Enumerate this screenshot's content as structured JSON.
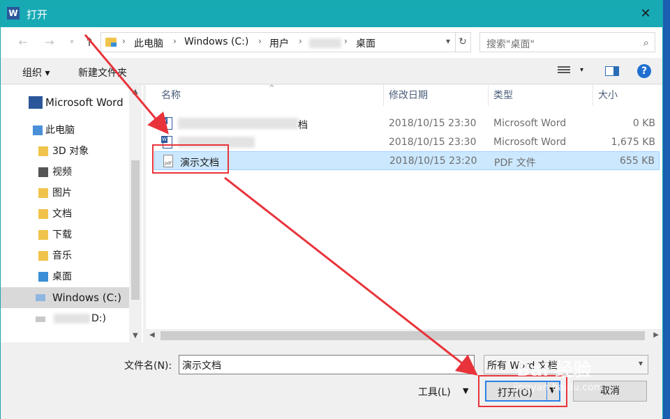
{
  "title": "打开",
  "app_icon": "word-icon",
  "nav": {
    "back_icon": "back-arrow-icon",
    "forward_icon": "forward-arrow-icon",
    "recent_icon": "chevron-down-icon",
    "up_icon": "up-arrow-icon"
  },
  "address": {
    "crumbs": [
      "此电脑",
      "Windows (C:)",
      "用户",
      "桌面"
    ],
    "separator": "›"
  },
  "search": {
    "placeholder": "搜索\"桌面\""
  },
  "toolbar": {
    "organize": "组织 ▾",
    "new_folder": "新建文件夹"
  },
  "sidebar": {
    "items": [
      {
        "label": "Microsoft Word",
        "icon": "word-icon"
      },
      {
        "label": "此电脑",
        "icon": "computer-icon"
      },
      {
        "label": "3D 对象",
        "icon": "folder-3d-icon"
      },
      {
        "label": "视频",
        "icon": "video-folder-icon"
      },
      {
        "label": "图片",
        "icon": "pictures-folder-icon"
      },
      {
        "label": "文档",
        "icon": "documents-folder-icon"
      },
      {
        "label": "下载",
        "icon": "downloads-folder-icon"
      },
      {
        "label": "音乐",
        "icon": "music-folder-icon"
      },
      {
        "label": "桌面",
        "icon": "desktop-folder-icon"
      },
      {
        "label": "Windows (C:)",
        "icon": "drive-icon"
      },
      {
        "label": "D:)",
        "icon": "drive-icon"
      }
    ]
  },
  "columns": {
    "name": "名称",
    "date": "修改日期",
    "type": "类型",
    "size": "大小"
  },
  "files": [
    {
      "name": "档",
      "date": "2018/10/15 23:30",
      "type": "Microsoft Word",
      "size": "0 KB"
    },
    {
      "name": "",
      "date": "2018/10/15 23:30",
      "type": "Microsoft Word",
      "size": "1,675 KB"
    },
    {
      "name": "演示文档",
      "date": "2018/10/15 23:20",
      "type": "PDF 文件",
      "size": "655 KB"
    }
  ],
  "bottom": {
    "filename_label": "文件名(N):",
    "filename_value": "演示文档",
    "filetype_value": "所有 Word 文档",
    "tools_label": "工具(L)",
    "open_label": "打开(O)",
    "cancel_label": "取消"
  },
  "watermark": {
    "brand": "Bai 经验",
    "url": "jingyan.baidu.com"
  },
  "colors": {
    "titlebar": "#17aab5",
    "selection": "#cce8ff",
    "annotation": "#e8333a",
    "accent": "#2a80e6"
  }
}
